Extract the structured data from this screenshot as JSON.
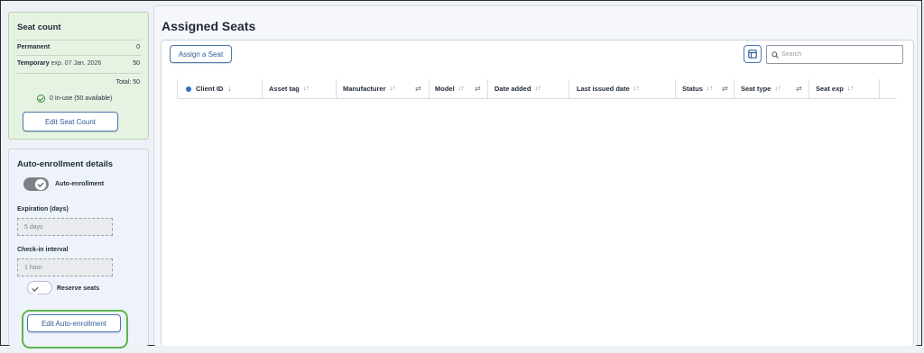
{
  "seat_count": {
    "title": "Seat count",
    "permanent_label": "Permanent",
    "permanent_value": "0",
    "temporary_label": "Temporary",
    "temporary_exp": "exp. 07 Jan. 2026",
    "temporary_value": "50",
    "total": "Total: 50",
    "inuse": "0 In-use (50 available)",
    "edit_button": "Edit Seat Count"
  },
  "auto_enrollment": {
    "title": "Auto-enrollment details",
    "toggle_label": "Auto-enrollment",
    "toggle_on": true,
    "expiration_label": "Expiration (days)",
    "expiration_value": "5 days",
    "checkin_label": "Check-in interval",
    "checkin_value": "1 hour",
    "reserve_label": "Reserve seats",
    "reserve_on": false,
    "edit_button": "Edit Auto-enrollment",
    "highlight_color": "#5eb34f"
  },
  "main": {
    "title": "Assigned Seats",
    "assign_button": "Assign a Seat",
    "search_placeholder": "Search",
    "columns": [
      {
        "label": "Client ID",
        "sort": "↓",
        "filter": false
      },
      {
        "label": "Asset tag",
        "sort": "↓↑",
        "filter": false
      },
      {
        "label": "Manufacturer",
        "sort": "↓↑",
        "filter": true
      },
      {
        "label": "Model",
        "sort": "↓↑",
        "filter": true
      },
      {
        "label": "Date added",
        "sort": "↓↑",
        "filter": false
      },
      {
        "label": "Last issued date",
        "sort": "↓↑",
        "filter": false
      },
      {
        "label": "Status",
        "sort": "↓↑",
        "filter": true
      },
      {
        "label": "Seat type",
        "sort": "↓↑",
        "filter": true
      },
      {
        "label": "Seat exp",
        "sort": "↓↑",
        "filter": false
      }
    ],
    "accent_color": "#2f6fbf"
  }
}
